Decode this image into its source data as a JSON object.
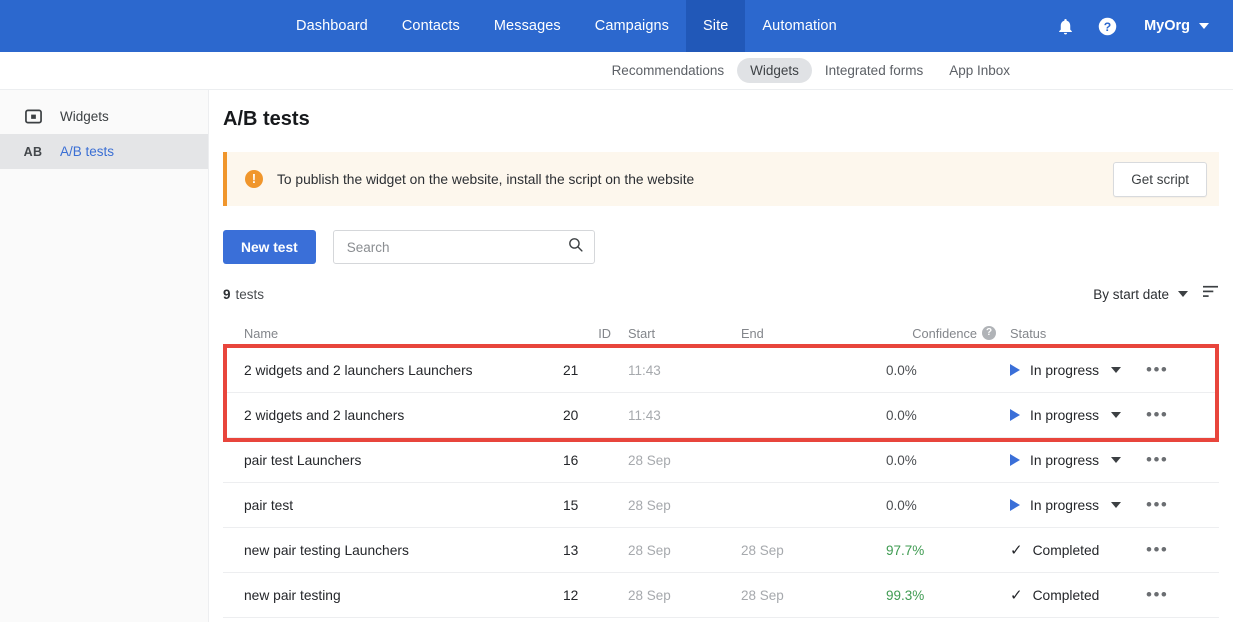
{
  "topnav": {
    "links": [
      {
        "label": "Dashboard",
        "active": false
      },
      {
        "label": "Contacts",
        "active": false
      },
      {
        "label": "Messages",
        "active": false
      },
      {
        "label": "Campaigns",
        "active": false
      },
      {
        "label": "Site",
        "active": true
      },
      {
        "label": "Automation",
        "active": false
      }
    ],
    "bell_icon": "bell-icon",
    "help_icon": "help-icon",
    "org": "MyOrg"
  },
  "subnav": {
    "items": [
      {
        "label": "Recommendations",
        "active": false
      },
      {
        "label": "Widgets",
        "active": true
      },
      {
        "label": "Integrated forms",
        "active": false
      },
      {
        "label": "App Inbox",
        "active": false
      }
    ]
  },
  "sidebar": {
    "items": [
      {
        "label": "Widgets",
        "icon": "widget-icon",
        "active": false
      },
      {
        "label": "A/B tests",
        "icon": "ab-icon",
        "active": true
      }
    ]
  },
  "main": {
    "title": "A/B tests",
    "banner": {
      "icon": "warning-icon",
      "text": "To publish the widget on the website, install the script on the website",
      "button": "Get script"
    },
    "toolbar": {
      "new_test_label": "New test",
      "search_placeholder": "Search",
      "search_value": "",
      "search_icon": "search-icon"
    },
    "count": {
      "number": "9",
      "label": "tests"
    },
    "sort": {
      "label": "By start date",
      "order_icon": "sort-order-icon"
    },
    "table": {
      "headers": {
        "name": "Name",
        "id": "ID",
        "start": "Start",
        "end": "End",
        "confidence": "Confidence",
        "status": "Status"
      },
      "rows": [
        {
          "name": "2 widgets and 2 launchers Launchers",
          "id": "21",
          "start": "11:43",
          "end": "",
          "confidence": "0.0%",
          "confidence_high": false,
          "status": "In progress",
          "status_type": "in-progress",
          "highlighted": true
        },
        {
          "name": "2 widgets and 2 launchers",
          "id": "20",
          "start": "11:43",
          "end": "",
          "confidence": "0.0%",
          "confidence_high": false,
          "status": "In progress",
          "status_type": "in-progress",
          "highlighted": true
        },
        {
          "name": "pair test Launchers",
          "id": "16",
          "start": "28 Sep",
          "end": "",
          "confidence": "0.0%",
          "confidence_high": false,
          "status": "In progress",
          "status_type": "in-progress",
          "highlighted": false
        },
        {
          "name": "pair test",
          "id": "15",
          "start": "28 Sep",
          "end": "",
          "confidence": "0.0%",
          "confidence_high": false,
          "status": "In progress",
          "status_type": "in-progress",
          "highlighted": false
        },
        {
          "name": "new pair testing Launchers",
          "id": "13",
          "start": "28 Sep",
          "end": "28 Sep",
          "confidence": "97.7%",
          "confidence_high": true,
          "status": "Completed",
          "status_type": "completed",
          "highlighted": false
        },
        {
          "name": "new pair testing",
          "id": "12",
          "start": "28 Sep",
          "end": "28 Sep",
          "confidence": "99.3%",
          "confidence_high": true,
          "status": "Completed",
          "status_type": "completed",
          "highlighted": false
        }
      ],
      "row_action_icon": "more-options-icon"
    }
  },
  "colors": {
    "brand_blue": "#2c68ce",
    "accent_blue": "#3a6fd8",
    "warning_orange": "#f0962c",
    "success_green": "#3f9b52",
    "highlight_red": "#e8453c"
  }
}
